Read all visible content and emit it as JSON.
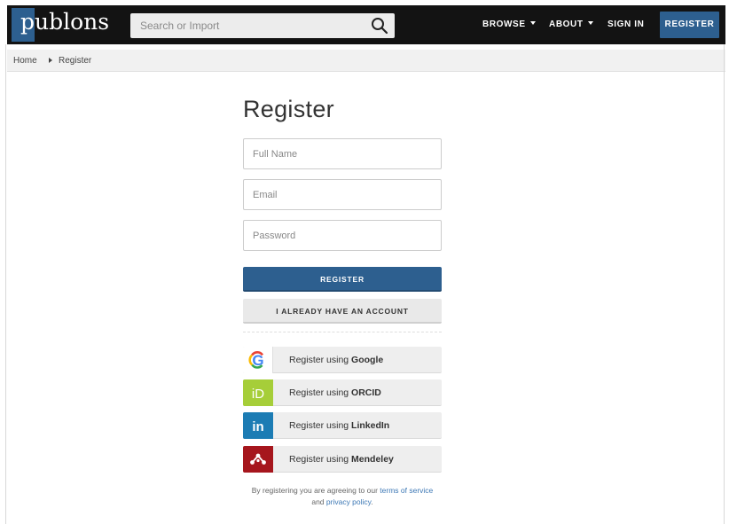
{
  "header": {
    "logo_text": "publons",
    "search_placeholder": "Search or Import",
    "nav": {
      "browse": "BROWSE",
      "about": "ABOUT",
      "sign_in": "SIGN IN",
      "register": "REGISTER"
    }
  },
  "breadcrumb": {
    "home": "Home",
    "current": "Register"
  },
  "form": {
    "title": "Register",
    "full_name_placeholder": "Full Name",
    "email_placeholder": "Email",
    "password_placeholder": "Password",
    "register_button": "REGISTER",
    "have_account_button": "I ALREADY HAVE AN ACCOUNT"
  },
  "social": [
    {
      "prefix": "Register using ",
      "provider": "Google",
      "icon": "google-icon",
      "color": "#ffffff"
    },
    {
      "prefix": "Register using ",
      "provider": "ORCID",
      "icon": "orcid-icon",
      "color": "#a6ce39"
    },
    {
      "prefix": "Register using ",
      "provider": "LinkedIn",
      "icon": "linkedin-icon",
      "color": "#1c7cb4"
    },
    {
      "prefix": "Register using ",
      "provider": "Mendeley",
      "icon": "mendeley-icon",
      "color": "#a6161d"
    }
  ],
  "terms": {
    "before": "By registering you are agreeing to our ",
    "tos_link": "terms of service",
    "middle": "and ",
    "privacy_link": "privacy policy",
    "end": "."
  },
  "colors": {
    "brand": "#2d5f8f",
    "topbar": "#131313",
    "link": "#3d78b5"
  }
}
